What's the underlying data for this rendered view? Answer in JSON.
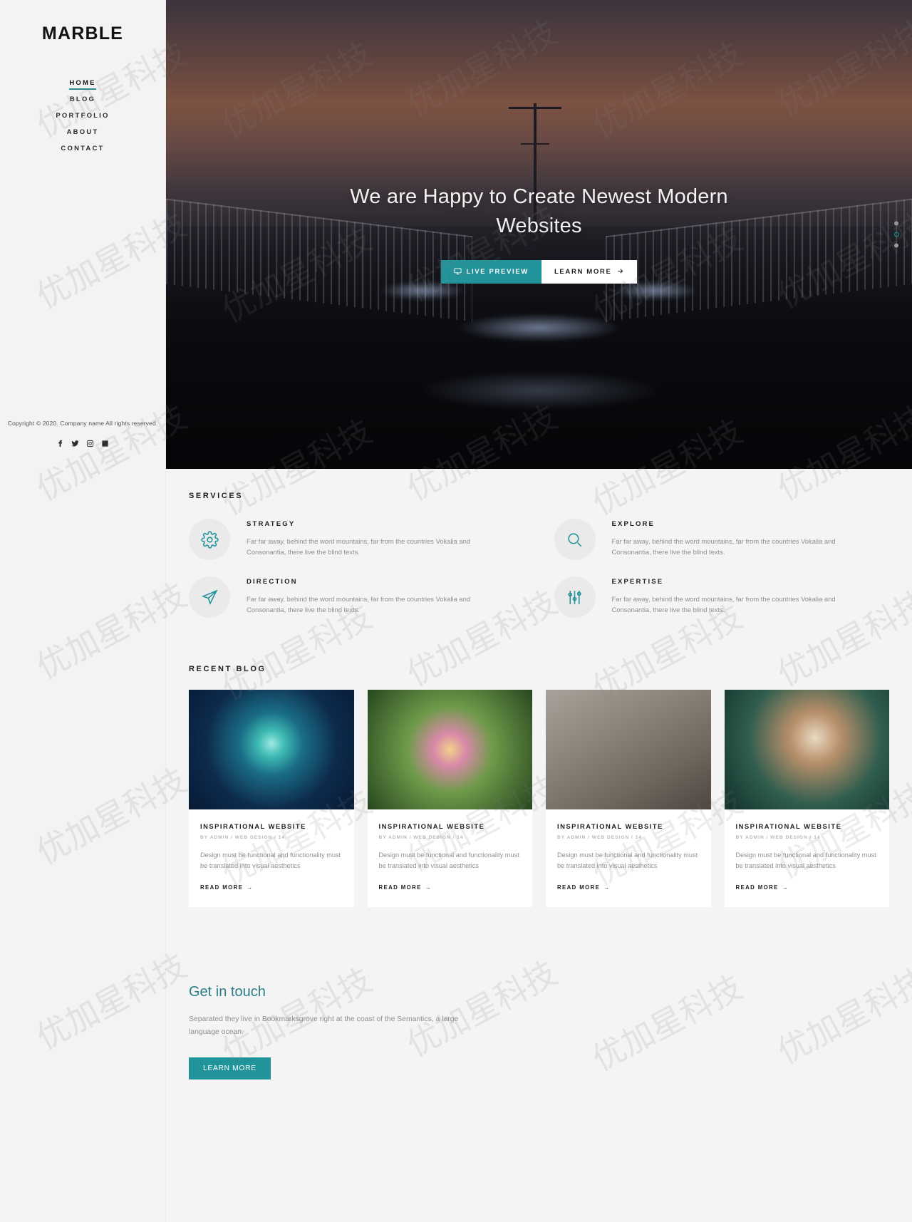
{
  "sidebar": {
    "brand": "MARBLE",
    "nav": [
      {
        "label": "HOME",
        "active": true
      },
      {
        "label": "BLOG",
        "active": false
      },
      {
        "label": "PORTFOLIO",
        "active": false
      },
      {
        "label": "ABOUT",
        "active": false
      },
      {
        "label": "CONTACT",
        "active": false
      }
    ],
    "copyright": "Copyright © 2020. Company name All rights reserved.",
    "socials": [
      {
        "name": "facebook-icon"
      },
      {
        "name": "twitter-icon"
      },
      {
        "name": "instagram-icon"
      },
      {
        "name": "linkedin-icon"
      }
    ]
  },
  "hero": {
    "title": "We are Happy to Create Newest Modern Websites",
    "primary_button": "LIVE PREVIEW",
    "secondary_button": "LEARN MORE",
    "slides": 3,
    "active_slide": 2
  },
  "services": {
    "heading": "SERVICES",
    "items": [
      {
        "name": "STRATEGY",
        "icon": "gear-icon",
        "text": "Far far away, behind the word mountains, far from the countries Vokalia and Consonantia, there live the blind texts."
      },
      {
        "name": "EXPLORE",
        "icon": "magnifier-icon",
        "text": "Far far away, behind the word mountains, far from the countries Vokalia and Consonantia, there live the blind texts."
      },
      {
        "name": "DIRECTION",
        "icon": "paper-plane-icon",
        "text": "Far far away, behind the word mountains, far from the countries Vokalia and Consonantia, there live the blind texts."
      },
      {
        "name": "EXPERTISE",
        "icon": "sliders-icon",
        "text": "Far far away, behind the word mountains, far from the countries Vokalia and Consonantia, there live the blind texts."
      }
    ]
  },
  "blog": {
    "heading": "RECENT BLOG",
    "read_more": "READ MORE",
    "posts": [
      {
        "title": "INSPIRATIONAL WEBSITE",
        "meta": "BY ADMIN / WEB DESIGN / 14",
        "text": "Design must be functional and functionality must be translated into visual aesthetics"
      },
      {
        "title": "INSPIRATIONAL WEBSITE",
        "meta": "BY ADMIN / WEB DESIGN / 14",
        "text": "Design must be functional and functionality must be translated into visual aesthetics"
      },
      {
        "title": "INSPIRATIONAL WEBSITE",
        "meta": "BY ADMIN / WEB DESIGN / 14",
        "text": "Design must be functional and functionality must be translated into visual aesthetics"
      },
      {
        "title": "INSPIRATIONAL WEBSITE",
        "meta": "BY ADMIN / WEB DESIGN / 14",
        "text": "Design must be functional and functionality must be translated into visual aesthetics"
      }
    ]
  },
  "touch": {
    "title": "Get in touch",
    "text": "Separated they live in Bookmarksgrove right at the coast of the Semantics, a large language ocean.",
    "button": "LEARN MORE"
  },
  "watermark": {
    "text": "优加星科技"
  },
  "colors": {
    "accent": "#21949b",
    "accent_dark": "#2c7e86",
    "background": "#f4f4f4",
    "sidebar": "#f3f3f3",
    "muted_text": "#8f8f8f"
  }
}
